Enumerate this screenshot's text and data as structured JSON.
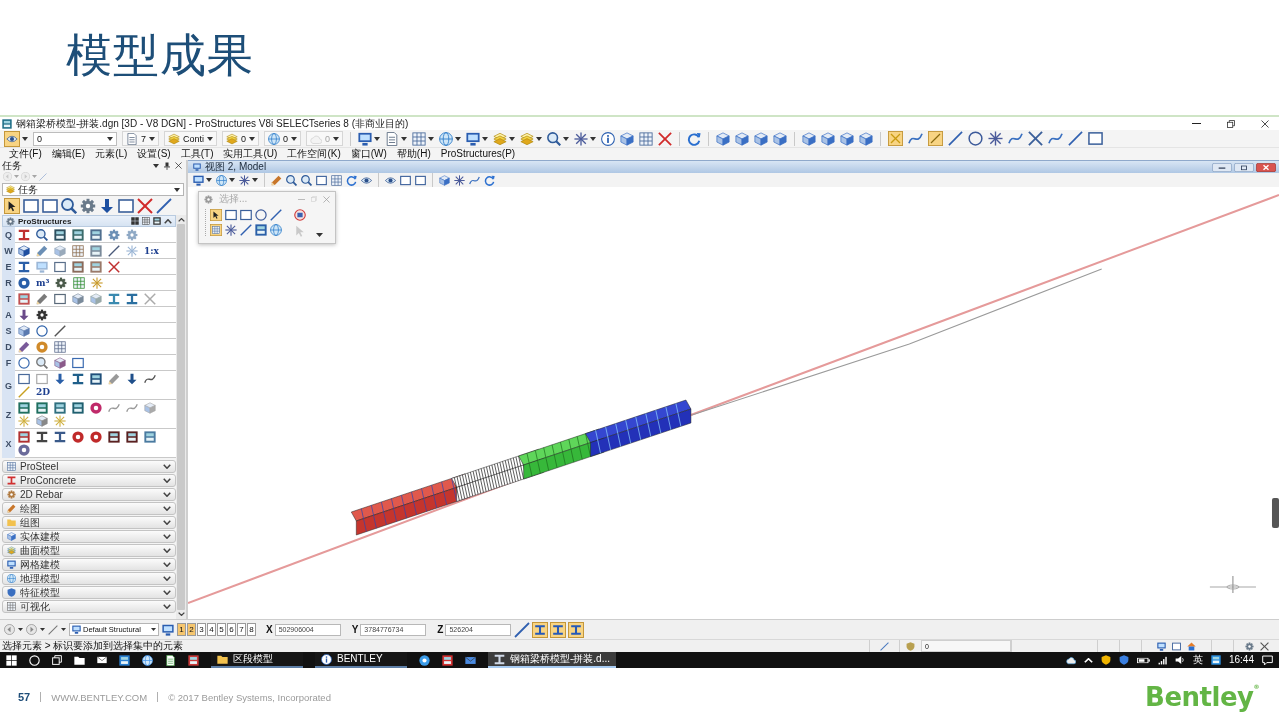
{
  "slide": {
    "title": "模型成果"
  },
  "window": {
    "title": "钢箱梁桥模型-拼装.dgn [3D - V8 DGN] - ProStructures V8i SELECTseries 8 (非商业目的)"
  },
  "selection_tool": {
    "selected": true
  },
  "attribute_toolbar": [
    {
      "kind": "field",
      "value": "0",
      "disabled": false
    },
    {
      "kind": "picker",
      "value": "7",
      "disabled": false
    },
    {
      "kind": "picker",
      "value": "Conti",
      "disabled": false
    },
    {
      "kind": "picker",
      "value": "0",
      "disabled": false
    },
    {
      "kind": "picker",
      "value": "0",
      "disabled": false
    },
    {
      "kind": "picker",
      "value": "0",
      "disabled": true
    }
  ],
  "snap_toolbar": [
    {
      "selected": true
    },
    {
      "selected": false
    },
    {
      "selected": true
    },
    {
      "selected": false
    },
    {
      "selected": false
    },
    {
      "selected": false
    },
    {
      "selected": false
    },
    {
      "selected": false
    },
    {
      "selected": false
    },
    {
      "selected": false
    },
    {
      "selected": false
    }
  ],
  "menu": [
    "文件(F)",
    "编辑(E)",
    "元素(L)",
    "设置(S)",
    "工具(T)",
    "实用工具(U)",
    "工作空间(K)",
    "窗口(W)",
    "帮助(H)",
    "ProStructures(P)"
  ],
  "task_panel": {
    "title": "任务",
    "dropdown": "任务",
    "tools": [
      {
        "selected": true
      },
      {
        "selected": false
      },
      {
        "selected": false
      },
      {
        "selected": false
      },
      {
        "selected": false
      },
      {
        "selected": false
      },
      {
        "selected": false
      },
      {
        "selected": false
      },
      {
        "selected": false
      }
    ],
    "section": {
      "title": "ProStructures",
      "expanded": true,
      "rows": [
        {
          "key": "Q"
        },
        {
          "key": "W",
          "labels": [
            "1:x"
          ]
        },
        {
          "key": "E"
        },
        {
          "key": "R",
          "labels": [
            "m³"
          ]
        },
        {
          "key": "T"
        },
        {
          "key": "A"
        },
        {
          "key": "S"
        },
        {
          "key": "D"
        },
        {
          "key": "F"
        },
        {
          "key": "G",
          "labels": [
            "2D"
          ]
        },
        {
          "key": "Z"
        },
        {
          "key": "X"
        }
      ]
    },
    "groups": [
      {
        "label": "ProSteel",
        "expanded": false
      },
      {
        "label": "ProConcrete",
        "expanded": false
      },
      {
        "label": "2D Rebar",
        "expanded": false
      },
      {
        "label": "绘图",
        "expanded": false
      },
      {
        "label": "组图",
        "expanded": false
      },
      {
        "label": "实体建模",
        "expanded": false
      },
      {
        "label": "曲面模型",
        "expanded": false
      },
      {
        "label": "网格建模",
        "expanded": false
      },
      {
        "label": "地理模型",
        "expanded": false
      },
      {
        "label": "特征模型",
        "expanded": false
      },
      {
        "label": "可视化",
        "expanded": false
      }
    ]
  },
  "view": {
    "title": "视图 2, Model"
  },
  "selection_dialog": {
    "title": "选择...",
    "modes": [
      {
        "selected": true
      },
      {
        "selected": false
      },
      {
        "selected": false
      },
      {
        "selected": false
      },
      {
        "selected": false
      }
    ],
    "methods": [
      {
        "selected": true
      },
      {
        "selected": false
      },
      {
        "selected": false
      },
      {
        "selected": false
      },
      {
        "selected": false
      }
    ]
  },
  "bottom_bar": {
    "view_group": "Default Structural",
    "views": [
      {
        "label": "1",
        "selected": true
      },
      {
        "label": "2",
        "selected": true
      },
      {
        "label": "3",
        "selected": false
      },
      {
        "label": "4",
        "selected": false
      },
      {
        "label": "5",
        "selected": false
      },
      {
        "label": "6",
        "selected": false
      },
      {
        "label": "7",
        "selected": false
      },
      {
        "label": "8",
        "selected": false
      }
    ],
    "coordinates": [
      {
        "label": "X",
        "value": "502906004"
      },
      {
        "label": "Y",
        "value": "3784776734"
      },
      {
        "label": "Z",
        "value": "526204"
      }
    ],
    "toggles": [
      {
        "selected": false
      },
      {
        "selected": true
      },
      {
        "selected": true
      },
      {
        "selected": true
      }
    ]
  },
  "status_bar": {
    "prompt": "选择元素 > 标识要添加到选择集中的元素",
    "field": "0"
  },
  "taskbar": {
    "apps": [
      {
        "label": "区段模型",
        "selected": false
      },
      {
        "label": "BENTLEY",
        "selected": false
      },
      {
        "label": "钢箱梁桥模型-拼装.d...",
        "selected": true
      }
    ],
    "language": "英",
    "time": "16:44"
  },
  "footer": {
    "page": "57",
    "website": "WWW.BENTLEY.COM",
    "copyright": "© 2017 Bentley Systems, Incorporated",
    "logo": "Bentley$^{®}$"
  }
}
